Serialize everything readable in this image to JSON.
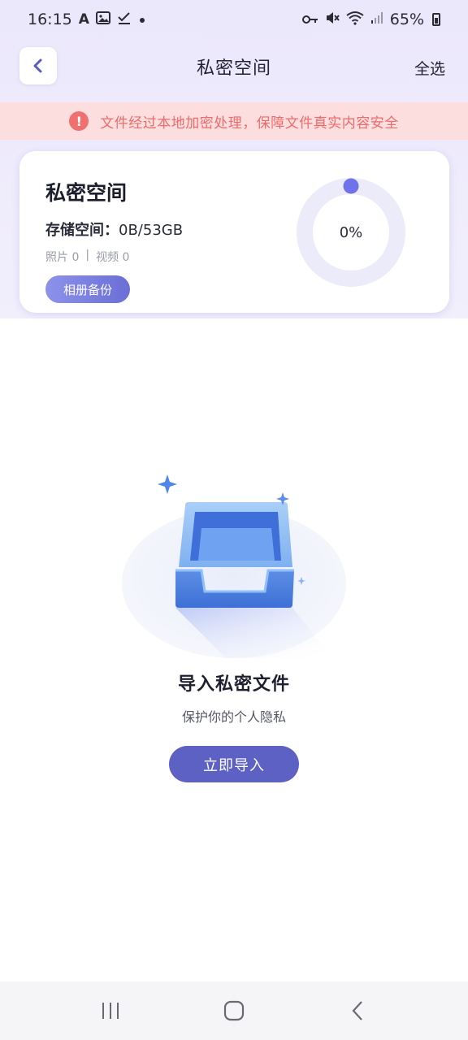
{
  "status_bar": {
    "time": "16:15",
    "battery": "65%",
    "left_icons": [
      "a-icon",
      "image-icon",
      "check-icon",
      "dot-icon"
    ],
    "right_icons": [
      "key-icon",
      "mute-icon",
      "wifi-icon",
      "signal-icon",
      "battery-icon"
    ]
  },
  "header": {
    "title": "私密空间",
    "select_all": "全选",
    "back_icon": "chevron-left-icon"
  },
  "notice": {
    "icon": "!",
    "text": "文件经过本地加密处理，保障文件真实内容安全"
  },
  "card": {
    "title": "私密空间",
    "storage_label": "存储空间：",
    "storage_value": "0B/53GB",
    "photos": "照片 0",
    "separator": "|",
    "videos": "视频 0",
    "backup_button": "相册备份",
    "usage_percent": "0%",
    "usage_fraction": 0
  },
  "empty_state": {
    "title": "导入私密文件",
    "subtitle": "保护你的个人隐私",
    "button": "立即导入"
  },
  "colors": {
    "accent": "#5e61c4",
    "notice_bg": "#fcdede",
    "notice_text": "#ef6b6b",
    "ring_track": "#ecebfa",
    "ring_dot": "#6f72e8"
  }
}
